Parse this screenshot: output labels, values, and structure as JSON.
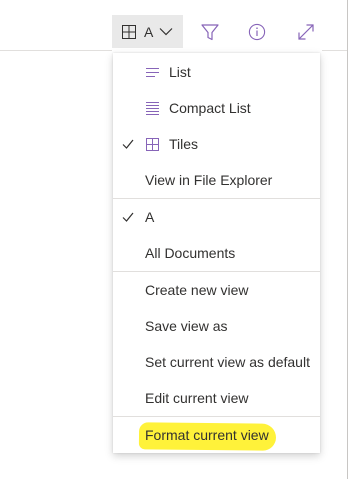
{
  "toolbar": {
    "view_switcher": {
      "label": "A",
      "icon": "grid-icon",
      "chevron": "chevron-down-icon"
    },
    "filter_icon": "filter-icon",
    "info_icon": "info-icon",
    "expand_icon": "expand-icon"
  },
  "menu": {
    "layout_items": [
      {
        "label": "List",
        "icon": "list-icon",
        "checked": false
      },
      {
        "label": "Compact List",
        "icon": "compact-list-icon",
        "checked": false
      },
      {
        "label": "Tiles",
        "icon": "tiles-icon",
        "checked": true
      },
      {
        "label": "View in File Explorer",
        "icon": "",
        "checked": false
      }
    ],
    "view_items": [
      {
        "label": "A",
        "checked": true
      },
      {
        "label": "All Documents",
        "checked": false
      }
    ],
    "action_items": [
      {
        "label": "Create new view"
      },
      {
        "label": "Save view as"
      },
      {
        "label": "Set current view as default"
      },
      {
        "label": "Edit current view"
      }
    ],
    "format_item": {
      "label": "Format current view",
      "highlighted": true
    }
  },
  "colors": {
    "accent_purple": "#8764b8",
    "highlight_yellow": "#fff23a",
    "text": "#323130",
    "separator": "#e1dfdd",
    "switcher_bg": "#e9e9e9"
  }
}
